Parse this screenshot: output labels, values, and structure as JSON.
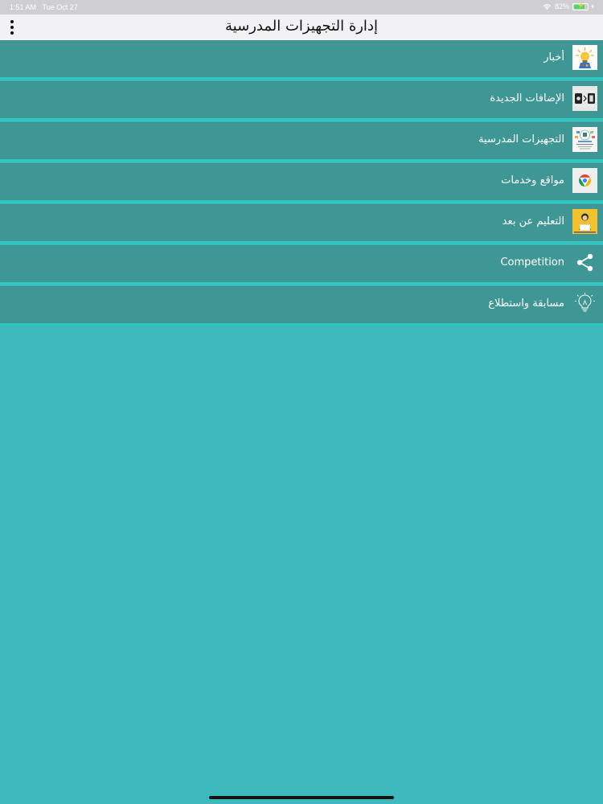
{
  "status_bar": {
    "time": "1:51 AM",
    "date": "Tue Oct 27",
    "battery": "82%",
    "battery_level": 0.82
  },
  "app_bar": {
    "title": "إدارة التجهيزات المدرسية"
  },
  "menu": [
    {
      "label": "أخبار",
      "icon": "news-lightbulb-icon"
    },
    {
      "label": "الإضافات الجديدة",
      "icon": "new-additions-icon"
    },
    {
      "label": "التجهيزات المدرسية",
      "icon": "school-equipment-icon"
    },
    {
      "label": "مواقع وخدمات",
      "icon": "chrome-browser-icon"
    },
    {
      "label": "التعليم عن بعد",
      "icon": "distance-learning-icon"
    },
    {
      "label": "Competition",
      "icon": "share-icon"
    },
    {
      "label": "مسابقة واستطلاع",
      "icon": "lightbulb-icon"
    }
  ],
  "colors": {
    "background": "#3dbabd",
    "menu_item": "#3e9794",
    "divider": "#2fc8c1",
    "app_bar": "#f2f2f4",
    "status_bar": "#cfcfd2"
  }
}
